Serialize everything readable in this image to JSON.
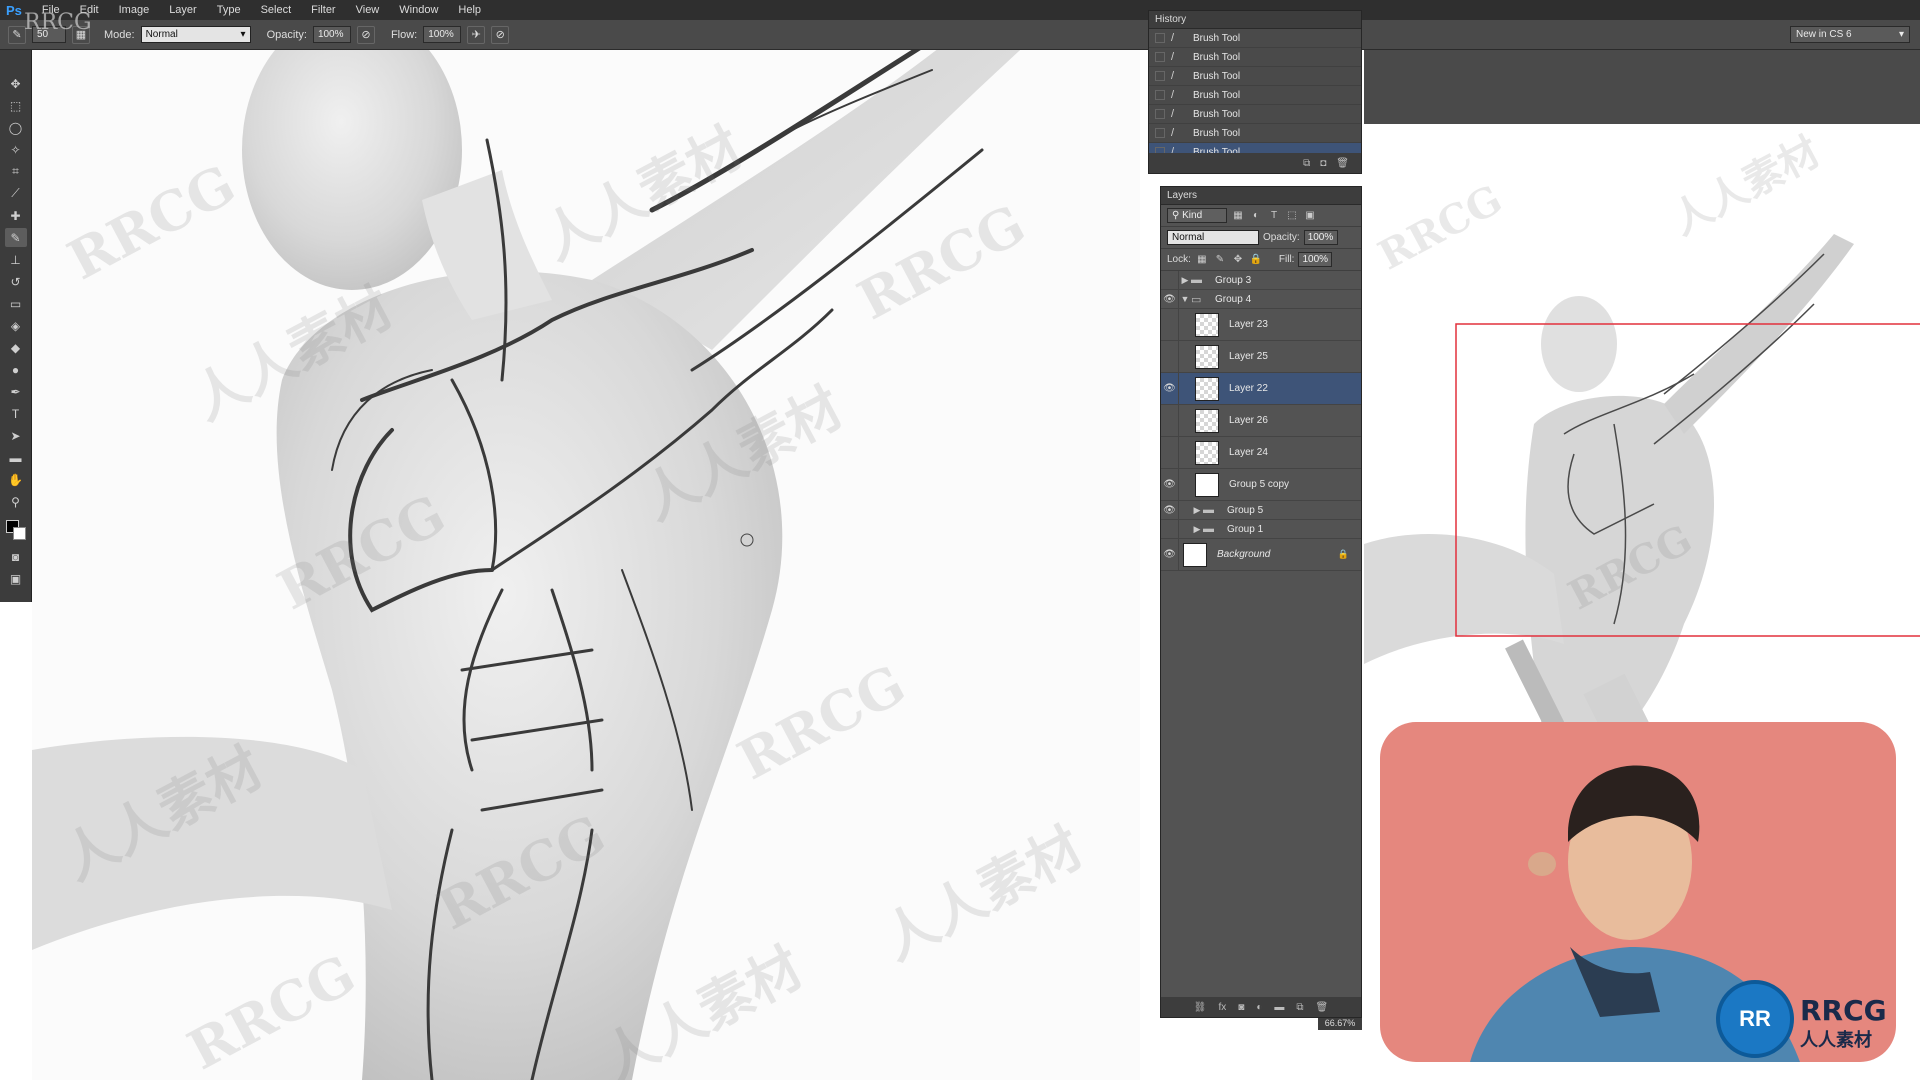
{
  "menubar": {
    "logo": "Ps",
    "items": [
      "File",
      "Edit",
      "Image",
      "Layer",
      "Type",
      "Select",
      "Filter",
      "View",
      "Window",
      "Help"
    ]
  },
  "options": {
    "brush_size": "50",
    "mode_label": "Mode:",
    "mode_value": "Normal",
    "opacity_label": "Opacity:",
    "opacity_value": "100%",
    "flow_label": "Flow:",
    "flow_value": "100%",
    "workspace": "New in CS 6"
  },
  "history": {
    "title": "History",
    "items": [
      "Brush Tool",
      "Brush Tool",
      "Brush Tool",
      "Brush Tool",
      "Brush Tool",
      "Brush Tool",
      "Brush Tool"
    ],
    "selected_index": 6
  },
  "layers": {
    "title": "Layers",
    "kind": "Kind",
    "blend_mode": "Normal",
    "opacity_label": "Opacity:",
    "opacity_value": "100%",
    "lock_label": "Lock:",
    "fill_label": "Fill:",
    "fill_value": "100%",
    "items": [
      {
        "name": "Group 3",
        "type": "group",
        "visible": false,
        "expanded": false
      },
      {
        "name": "Group 4",
        "type": "group",
        "visible": true,
        "expanded": true
      },
      {
        "name": "Layer 23",
        "type": "pixel",
        "visible": false
      },
      {
        "name": "Layer 25",
        "type": "pixel",
        "visible": false
      },
      {
        "name": "Layer 22",
        "type": "pixel",
        "visible": true,
        "selected": true
      },
      {
        "name": "Layer 26",
        "type": "pixel",
        "visible": false
      },
      {
        "name": "Layer 24",
        "type": "pixel",
        "visible": false
      },
      {
        "name": "Group 5 copy",
        "type": "smart",
        "visible": true
      },
      {
        "name": "Group 5",
        "type": "group",
        "visible": true,
        "expanded": false
      },
      {
        "name": "Group 1",
        "type": "group",
        "visible": false,
        "expanded": false
      },
      {
        "name": "Background",
        "type": "background",
        "visible": true,
        "locked": true
      }
    ]
  },
  "navigator": {
    "zoom": "66.67%"
  },
  "watermark": {
    "text_latin": "RRCG",
    "text_cn": "人人素材"
  },
  "branding": {
    "corner_mark": "RRCG",
    "logo_mark": "RR",
    "logo_text": "RRCG",
    "logo_sub": "人人素材"
  },
  "colors": {
    "accent_selected": "#3e5478",
    "panel_bg": "#535353",
    "webcam_bg": "#e5877e",
    "nav_frame": "#e2303c"
  }
}
